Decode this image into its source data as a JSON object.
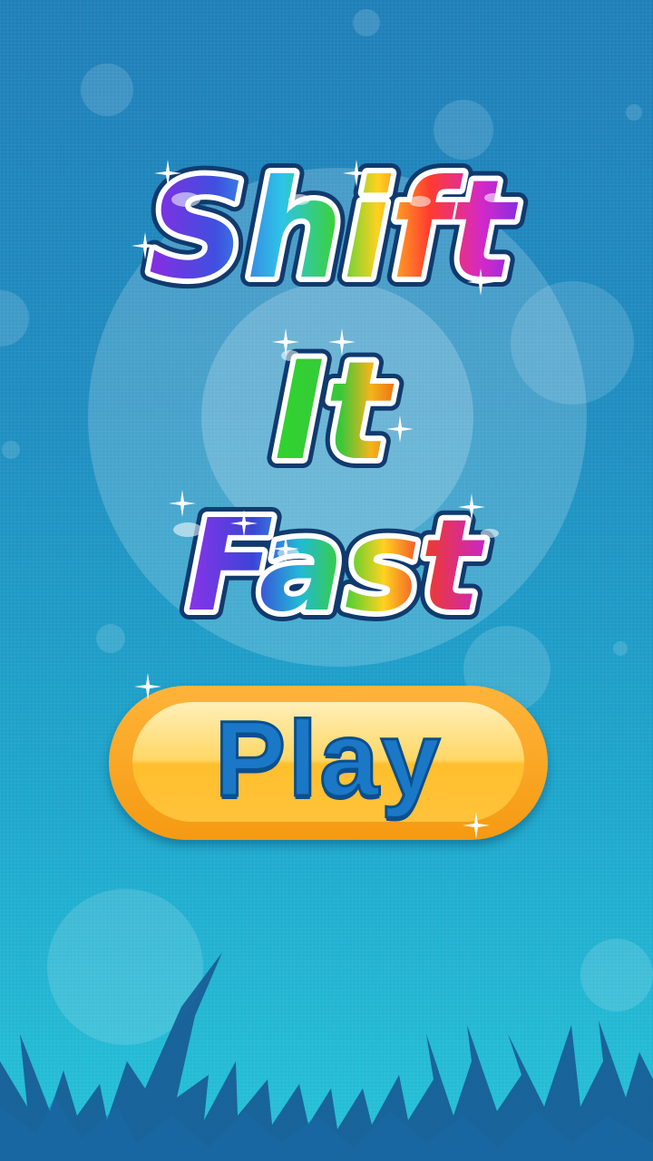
{
  "title": {
    "line1": "Shift",
    "line2": "It",
    "line3": "Fast"
  },
  "play_button": {
    "label": "Play"
  },
  "colors": {
    "background_top": "#1f7fb8",
    "background_bottom": "#26c2d8",
    "button_orange": "#f59a12",
    "button_yellow": "#ffd766",
    "play_text_blue": "#1a78c6",
    "grass_dark": "#175a94"
  },
  "icons": [
    "sparkle-icon",
    "grass-silhouette"
  ]
}
